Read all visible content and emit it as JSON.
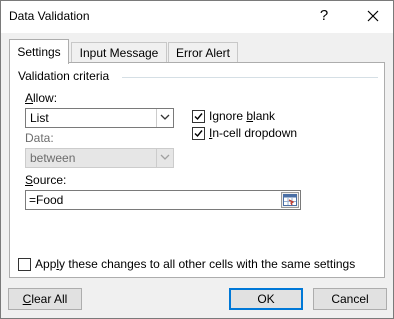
{
  "window": {
    "title": "Data Validation",
    "help_label": "?",
    "close_label": "✕"
  },
  "tabs": [
    {
      "label": "Settings",
      "active": true
    },
    {
      "label": "Input Message",
      "active": false
    },
    {
      "label": "Error Alert",
      "active": false
    }
  ],
  "settings": {
    "group_title": "Validation criteria",
    "allow": {
      "label_prefix": "",
      "label_underline": "A",
      "label_rest": "llow:",
      "selected": "List"
    },
    "ignore_blank": {
      "label_pre": "Ignore ",
      "label_underline": "b",
      "label_rest": "lank",
      "checked": true
    },
    "in_cell_dropdown": {
      "label_pre": "",
      "label_underline": "I",
      "label_rest": "n-cell dropdown",
      "checked": true
    },
    "data": {
      "label": "Data:",
      "selected": "between",
      "disabled": true
    },
    "source": {
      "label_underline": "S",
      "label_rest": "ource:",
      "value": "=Food"
    },
    "apply_all": {
      "label_pre": "Apply ",
      "label_underline": "",
      "label_first": "A",
      "label_mid": "pp",
      "label_underline2": "l",
      "label_rest": "y these changes to all other cells with the same settings",
      "checked": false
    }
  },
  "buttons": {
    "clear_all_underline": "C",
    "clear_all_rest": "lear All",
    "ok": "OK",
    "cancel": "Cancel"
  },
  "colors": {
    "accent": "#0078d7",
    "check": "#000000"
  }
}
